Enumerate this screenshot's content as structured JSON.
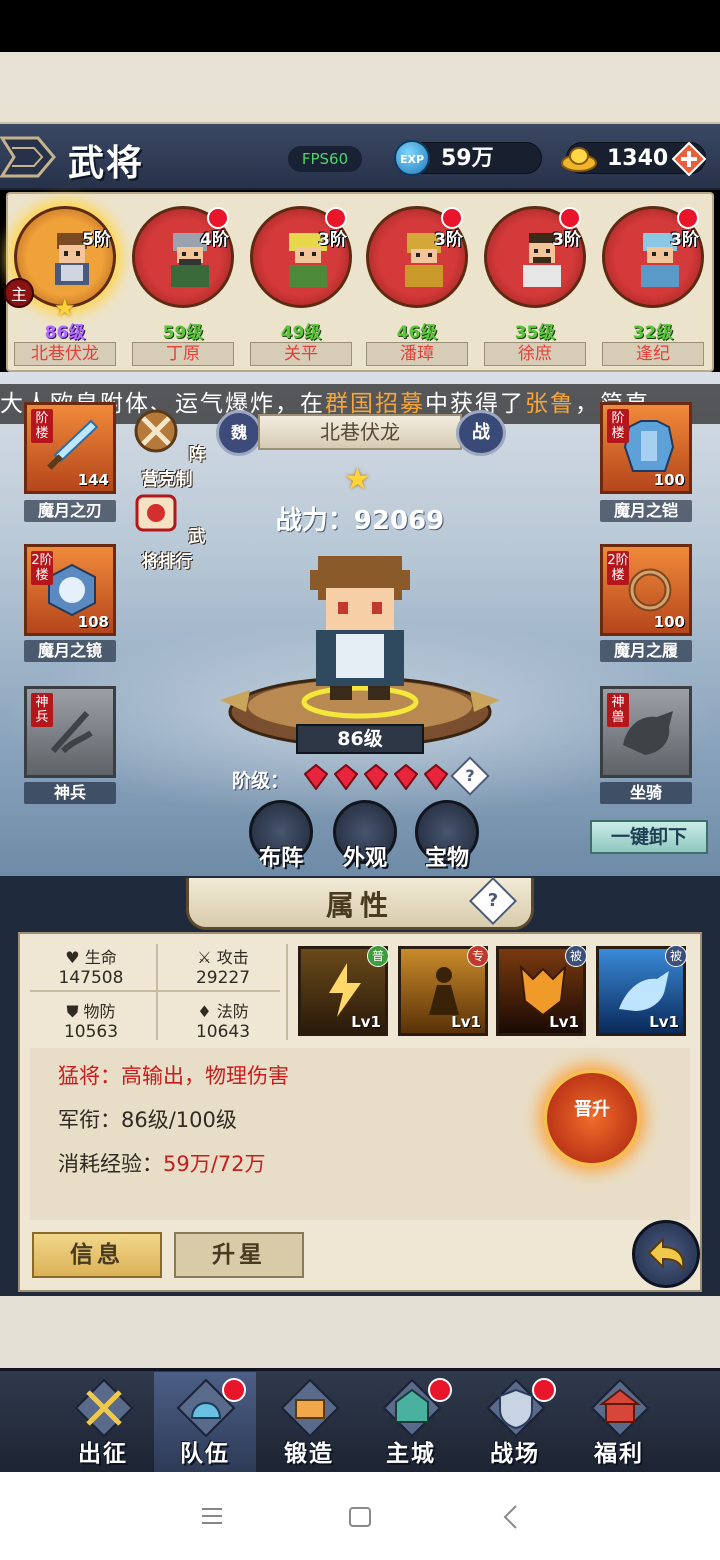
{
  "header": {
    "title": "武将",
    "fps": "FPS60",
    "exp_icon_text": "EXP",
    "exp_value": "59万",
    "gold_value": "1340"
  },
  "heroes": [
    {
      "name": "北巷伏龙",
      "level": "86级",
      "stage": "5阶",
      "selected": true,
      "dot": false
    },
    {
      "name": "丁原",
      "level": "59级",
      "stage": "4阶",
      "selected": false,
      "dot": true
    },
    {
      "name": "关平",
      "level": "49级",
      "stage": "3阶",
      "selected": false,
      "dot": true
    },
    {
      "name": "潘璋",
      "level": "46级",
      "stage": "3阶",
      "selected": false,
      "dot": true
    },
    {
      "name": "徐庶",
      "level": "35级",
      "stage": "3阶",
      "selected": false,
      "dot": true
    },
    {
      "name": "逢纪",
      "level": "32级",
      "stage": "3阶",
      "selected": false,
      "dot": true
    }
  ],
  "main_badge": "主",
  "ticker": {
    "part1": "大人欧皇附体、运气爆炸，在",
    "highlight1": "群国招募",
    "part2": "中获得了",
    "highlight2": "张鲁",
    "part3": "，简直"
  },
  "scene": {
    "faction": "魏",
    "hero_title": "北巷伏龙",
    "role": "战",
    "power": "战力：92069",
    "hero_level": "86级",
    "rank_label": "阶级：",
    "rank_help": "?",
    "shortcut_camp": "阵营克制",
    "shortcut_rank": "武将排行",
    "unequip_all": "一键卸下"
  },
  "equipment": {
    "weapon": {
      "label": "魔月之刃",
      "count": "144",
      "tag": "阶楼"
    },
    "armor": {
      "label": "魔月之铠",
      "count": "100",
      "tag": "阶楼"
    },
    "mirror": {
      "label": "魔月之镜",
      "count": "108",
      "tag": "2阶楼"
    },
    "boots": {
      "label": "魔月之履",
      "count": "100",
      "tag": "2阶楼"
    },
    "divine_weapon": {
      "label": "神兵",
      "tag": "神兵"
    },
    "mount": {
      "label": "坐骑",
      "tag": "神兽"
    }
  },
  "actions": {
    "formation": "布阵",
    "appearance": "外观",
    "treasure": "宝物"
  },
  "attributes": {
    "title": "属性",
    "help": "?",
    "hp_label": "生命",
    "hp_value": "147508",
    "atk_label": "攻击",
    "atk_value": "29227",
    "pdef_label": "物防",
    "pdef_value": "10563",
    "mdef_label": "法防",
    "mdef_value": "10643",
    "skills": [
      {
        "tag": "普",
        "level": "Lv1",
        "tag_color": "#3f9c3a"
      },
      {
        "tag": "专",
        "level": "Lv1",
        "tag_color": "#c0392b"
      },
      {
        "tag": "被",
        "level": "Lv1",
        "tag_color": "#3a4f7a"
      },
      {
        "tag": "被",
        "level": "Lv1",
        "tag_color": "#3a4f7a"
      }
    ],
    "desc_type": "猛将：高输出，物理伤害",
    "rank_prefix": "军衔：",
    "rank_value": "86级/100级",
    "exp_prefix": "消耗经验：",
    "exp_value": "59万/72万",
    "ascend": "晋升",
    "tab_info": "信息",
    "tab_star": "升星"
  },
  "bottom_nav": [
    {
      "label": "出征",
      "dot": false,
      "active": false
    },
    {
      "label": "队伍",
      "dot": true,
      "active": true
    },
    {
      "label": "锻造",
      "dot": false,
      "active": false
    },
    {
      "label": "主城",
      "dot": true,
      "active": false
    },
    {
      "label": "战场",
      "dot": true,
      "active": false
    },
    {
      "label": "福利",
      "dot": false,
      "active": false
    }
  ],
  "colors": {
    "accent_red": "#e8152b",
    "gold": "#ffd43b",
    "fps_green": "#4fd36c",
    "highlight_orange": "#f5a53a"
  }
}
